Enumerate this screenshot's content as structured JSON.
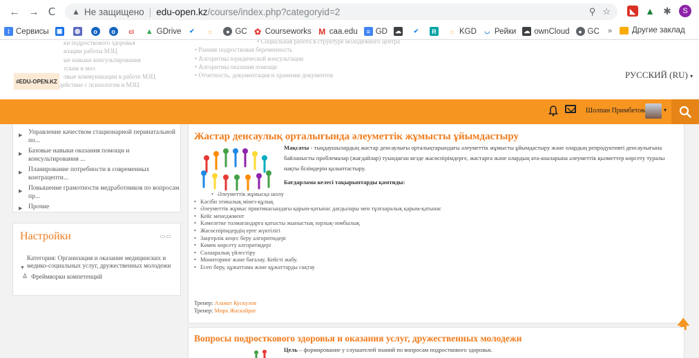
{
  "browser": {
    "nav": {
      "back": "←",
      "forward": "→",
      "reload": "C"
    },
    "url": {
      "warning": "Не защищено",
      "domain": "edu-open.kz",
      "path": "/course/index.php?categoryid=2"
    },
    "profile_letter": "S"
  },
  "bookmarks": {
    "items": [
      "Сервисы",
      "",
      "",
      "",
      "",
      "",
      "GDrive",
      "",
      "",
      "GC",
      "Courseworks",
      "caa.edu",
      "GD",
      "",
      "",
      "",
      "KGD",
      "Рейки",
      "ownCloud",
      "GC"
    ],
    "more": "»",
    "other": "Другие заклад"
  },
  "header": {
    "logo": "#EDU-OPEN.KZ",
    "language": "РУССКИЙ (RU)",
    "ghost_left": [
      "ки подросткового здоровья",
      "изации работы МЗЦ",
      "ые навыки консультирования",
      "тскии и мол",
      "овые коммуникации в работе МЗЦ",
      "• Взаимодействие с психологом и МЗЦ"
    ],
    "ghost_right": [
      "• Социальная работа в структуре молодежного центра",
      "• Ранняя подростковая беременность",
      "• Алгоритмы юридической консультации",
      "• Алгоритмы оказания помощи",
      "• Отчетность, документация и хранение документов"
    ]
  },
  "topbar": {
    "user_name": "Шолпан Примбетова",
    "colors": {
      "bar": "#f79521",
      "search": "#e68417"
    }
  },
  "sidebar": {
    "items": [
      "Управление качеством стационарной перинатальной по...",
      "Базовые навыки оказания помощи и консультирования ...",
      "Планирование потребности в современных контрацепти...",
      "Повышение грамотности медработников по вопросам пр...",
      "Прочие"
    ]
  },
  "settings": {
    "title": "Настройки",
    "category": "Категория: Организация и оказание медицинских и медико-социальных услуг, дружественных молодежи",
    "frameworks": "Фреймворки компетенций"
  },
  "course1": {
    "title": "Жастар денсаулық орталығында әлеуметтік жұмысты ұйымдастыру",
    "goal_label": "Мақсаты",
    "goal_text": " - тыңдаушылардың жастар денсаулығы орталықтарындағы әлеуметтік жұмысты ұйымдастыру және олардың репродуктивті денсаулығына байланысты проблемалар (жағдайлар) туындаған кезде жасөспірімдерге, жастарға және олардың ата-аналарына әлеуметтік қызметтер көрсету туралы нақты білімдерін қалыптастыру.",
    "program_head": "Бағдарлама келесі тақырыптарды қамтиды:",
    "topics": [
      "Әлеуметтік жұмысқа шолу",
      "Кәсіби этикалық мінез-құлық",
      "Әлеуметтік жұмыс практикасындағы қарым-қатынас дағдылары мен тұлғааралық қарым-қатынас",
      "Кейс менеджмент",
      "Кәмелетке толмағандарға қатысты жыныстық зорлық-зомбылық",
      "Жасөспірімдердің ерте жүктілігі",
      "Заңгерлік кеңес беру алгоритмдері",
      "Көмек көрсету алгоритмдері",
      "Салааралық үйлестіру",
      "Мониторинг және бағалау. Кейсті жабу.",
      "Есеп беру, құжаттама және құжаттарды сақтау"
    ],
    "trainer_label": "Тренер: ",
    "trainers": [
      "Азамат Кускулов",
      "Мира Жаскайрат"
    ]
  },
  "course2": {
    "title": "Вопросы подросткового здоровья и оказания услуг, дружественных молодежи",
    "goal_label": "Цель",
    "goal_text": " – формирование у слушателей знаний по вопросам подросткового здоровья."
  }
}
